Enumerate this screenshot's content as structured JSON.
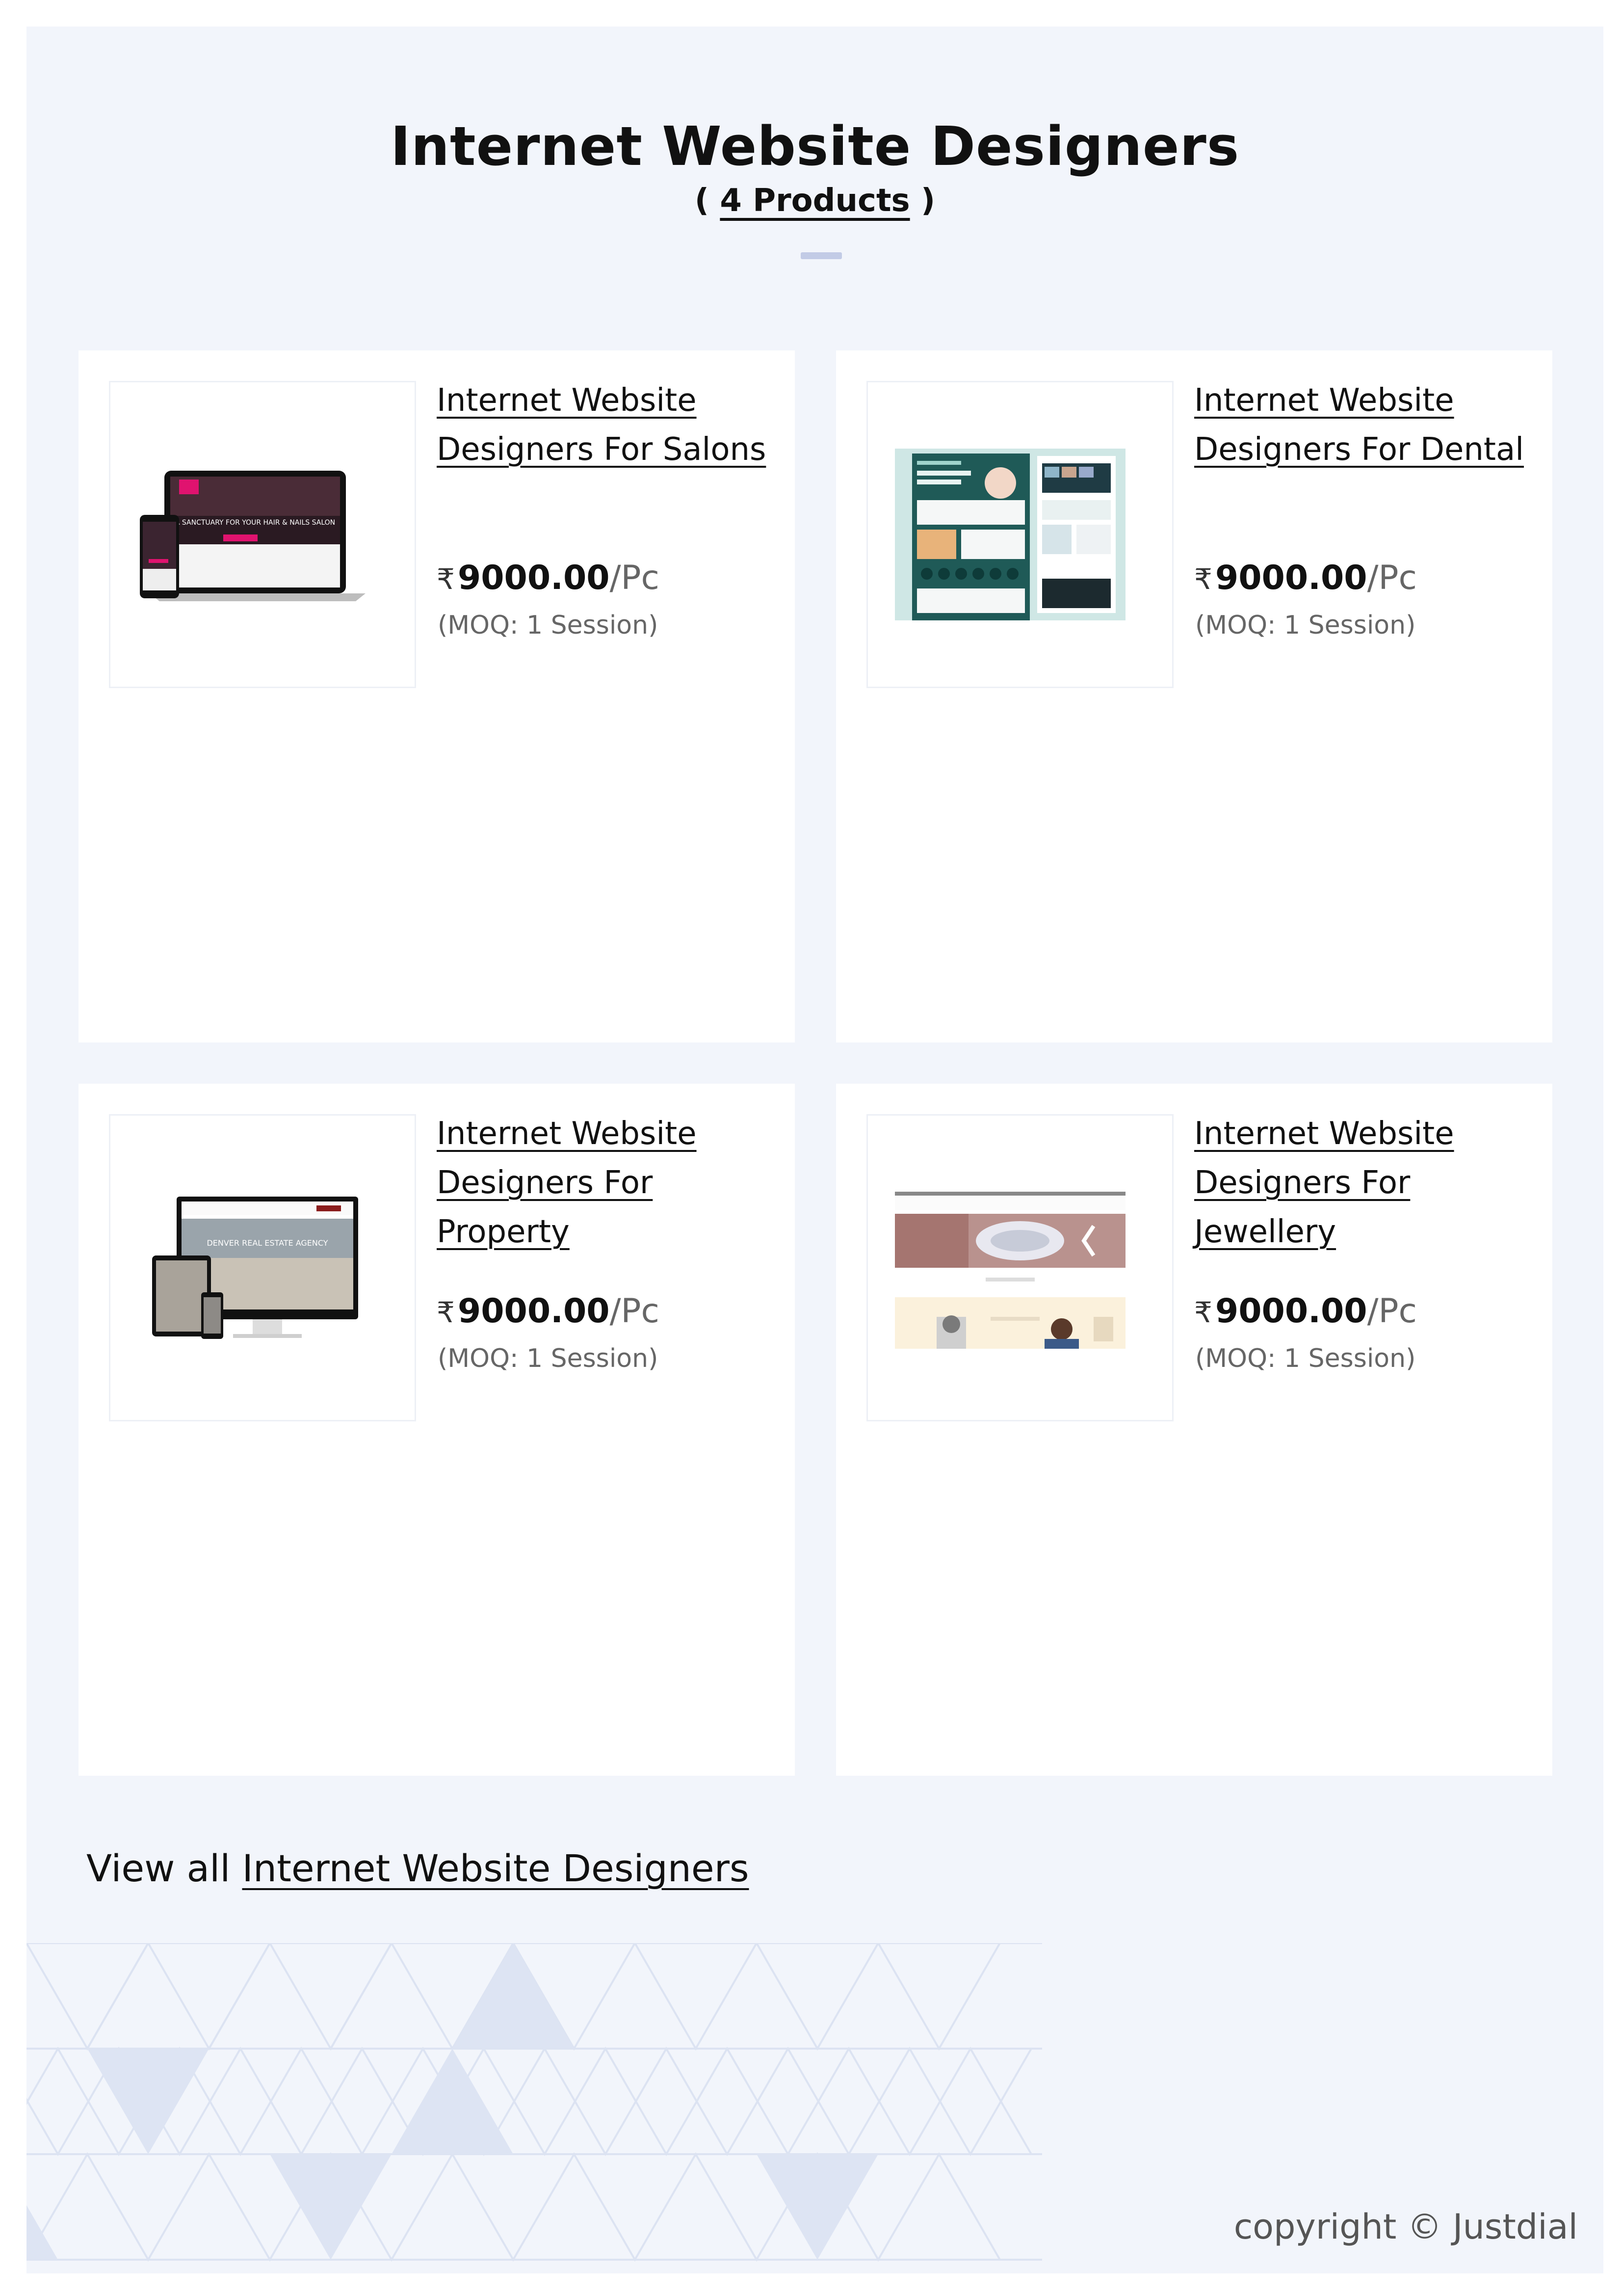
{
  "page": {
    "title": "Internet Website Designers",
    "count_open": "( ",
    "count_link": "4 Products",
    "count_close": " )"
  },
  "products": [
    {
      "name": "Internet Website Designers For Salons",
      "currency": "₹",
      "price": "9000.00",
      "unit": "/Pc",
      "moq": "(MOQ: 1 Session)"
    },
    {
      "name": "Internet Website Designers For Dental",
      "currency": "₹",
      "price": "9000.00",
      "unit": "/Pc",
      "moq": "(MOQ: 1 Session)"
    },
    {
      "name": "Internet Website Designers For Property",
      "currency": "₹",
      "price": "9000.00",
      "unit": "/Pc",
      "moq": "(MOQ: 1 Session)"
    },
    {
      "name": "Internet Website Designers For Jewellery",
      "currency": "₹",
      "price": "9000.00",
      "unit": "/Pc",
      "moq": "(MOQ: 1 Session)"
    }
  ],
  "view_all": {
    "prefix": "View all ",
    "link": "Internet Website Designers"
  },
  "footer": {
    "copyright": "copyright © Justdial"
  },
  "thumb_texts": {
    "salon": "A SANCTUARY FOR YOUR HAIR & NAILS SALON",
    "property": "DENVER REAL ESTATE AGENCY"
  },
  "colors": {
    "sheet_bg": "#f2f5fb",
    "card_bg": "#ffffff",
    "divider": "#c2cbe6",
    "pattern_line": "#dce3f2",
    "pattern_fill": "#dde4f3"
  }
}
